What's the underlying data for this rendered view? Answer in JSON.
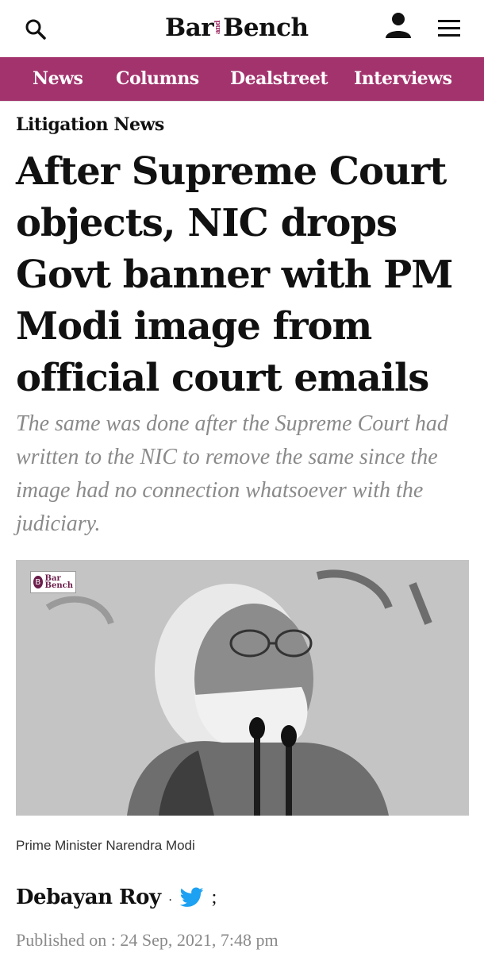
{
  "header": {
    "logo_left": "Bar",
    "logo_and": "and",
    "logo_right": "Bench",
    "icons": {
      "search": "search-icon",
      "user": "user-icon",
      "menu": "hamburger-menu-icon"
    }
  },
  "nav": {
    "items": [
      {
        "label": "News"
      },
      {
        "label": "Columns"
      },
      {
        "label": "Dealstreet"
      },
      {
        "label": "Interviews"
      }
    ]
  },
  "article": {
    "section": "Litigation News",
    "title": "After Supreme Court objects, NIC drops Govt banner with PM Modi image from official court emails",
    "subtitle": "The same was done after the Supreme Court had written to the NIC to remove the same since the image had no connection whatsoever with the judiciary.",
    "image_watermark_top": "Bar",
    "image_watermark_bottom": "Bench",
    "image_badge": "B",
    "caption": "Prime Minister Narendra Modi",
    "author": "Debayan Roy",
    "separator": ".",
    "semicolon": ";",
    "published": "Published on : 24 Sep, 2021, 7:48 pm"
  },
  "colors": {
    "brand_nav": "#a3336d",
    "twitter": "#1da1f2",
    "muted_text": "#8a8a8a"
  }
}
